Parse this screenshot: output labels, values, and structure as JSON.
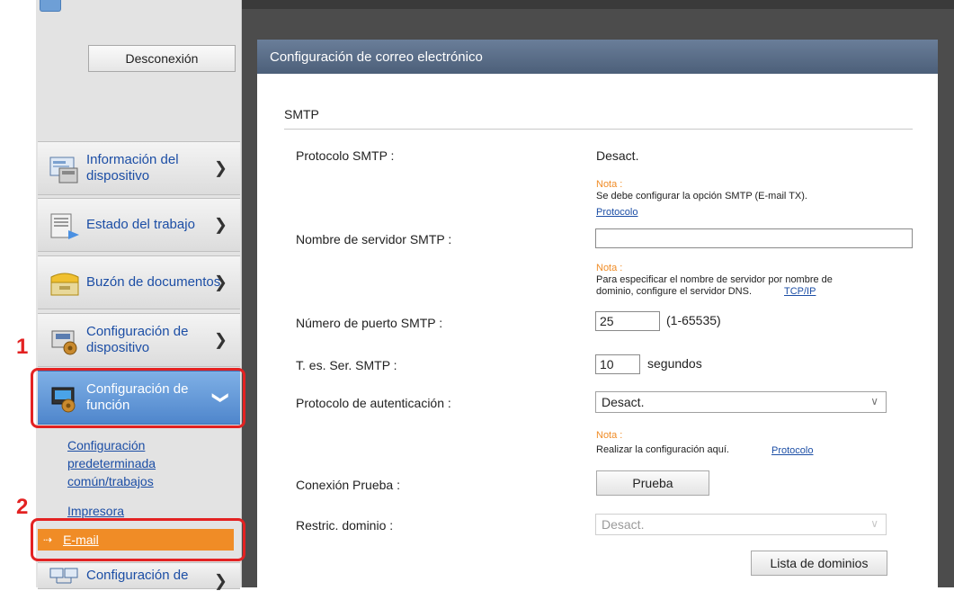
{
  "sidebar": {
    "logout_label": "Desconexión",
    "items": [
      {
        "label": "Información del dispositivo",
        "icon": "device-info-icon"
      },
      {
        "label": "Estado del trabajo",
        "icon": "job-status-icon"
      },
      {
        "label": "Buzón de documentos",
        "icon": "document-box-icon"
      },
      {
        "label": "Configuración de dispositivo",
        "icon": "device-settings-icon"
      },
      {
        "label": "Configuración de función",
        "icon": "function-settings-icon"
      },
      {
        "label": "Configuración de",
        "icon": "network-settings-icon"
      }
    ],
    "subitems": {
      "common": "Configuración predeterminada común/trabajos",
      "printer": "Impresora",
      "email": "E-mail"
    }
  },
  "callouts": {
    "step1": "1",
    "step2": "2"
  },
  "panel": {
    "title": "Configuración de correo electrónico",
    "section": "SMTP",
    "fields": {
      "protocol": {
        "label": "Protocolo SMTP :",
        "value": "Desact."
      },
      "note1": {
        "heading": "Nota :",
        "text": "Se debe configurar la opción SMTP (E-mail TX).",
        "link": "Protocolo"
      },
      "server": {
        "label": "Nombre de servidor SMTP :",
        "value": ""
      },
      "note2": {
        "heading": "Nota :",
        "text1": "Para especificar el nombre de servidor por nombre de",
        "text2": "dominio, configure el servidor DNS.",
        "link": "TCP/IP"
      },
      "port": {
        "label": "Número de puerto SMTP :",
        "value": "25",
        "range": "(1-65535)"
      },
      "timeout": {
        "label": "T. es. Ser. SMTP :",
        "value": "10",
        "unit": "segundos"
      },
      "auth": {
        "label": "Protocolo de autenticación :",
        "value": "Desact."
      },
      "note3": {
        "heading": "Nota :",
        "text": "Realizar la configuración aquí.",
        "link": "Protocolo"
      },
      "test": {
        "label": "Conexión Prueba :",
        "button": "Prueba"
      },
      "domain": {
        "label": "Restric. dominio :",
        "value": "Desact.",
        "button": "Lista de dominios"
      }
    }
  },
  "colors": {
    "accent_orange": "#f08c26",
    "callout_red": "#e32222",
    "link_blue": "#1c4ea5",
    "header_slate": "#5a6d88"
  }
}
